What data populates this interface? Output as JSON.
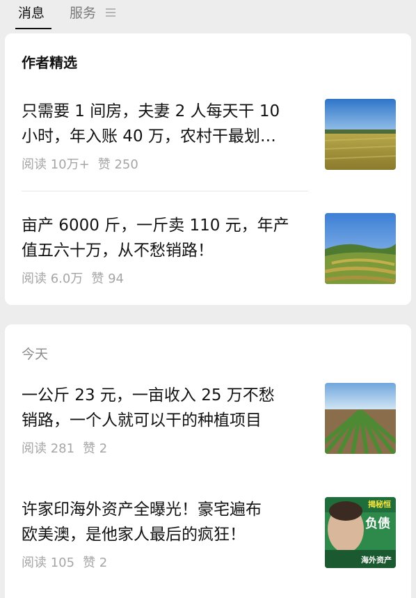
{
  "tabs": [
    {
      "label": "消息"
    },
    {
      "label": "服务"
    }
  ],
  "featured": {
    "title": "作者精选",
    "articles": [
      {
        "title_lines": [
          "只需要 1 间房，夫妻 2 人每天干 10",
          "小时，年入账 40 万，农村干最划…"
        ],
        "reads": "阅读 10万+",
        "likes": "赞 250",
        "thumb": "rice-field-image"
      },
      {
        "title_lines": [
          "亩产 6000 斤，一斤卖 110 元，年产",
          "值五六十万，从不愁销路！"
        ],
        "reads": "阅读 6.0万",
        "likes": "赞 94",
        "thumb": "terraced-field-image"
      }
    ]
  },
  "today": {
    "label": "今天",
    "articles": [
      {
        "title_lines": [
          "一公斤 23 元，一亩收入 25 万不愁",
          "销路，一个人就可以干的种植项目"
        ],
        "reads": "阅读 281",
        "likes": "赞 2",
        "thumb": "crop-rows-image"
      },
      {
        "title_lines": [
          "许家印海外资产全曝光！豪宅遍布",
          "欧美澳，是他家人最后的疯狂！"
        ],
        "reads": "阅读 105",
        "likes": "赞 2",
        "thumb": "news-portrait-image",
        "thumb_texts": [
          "揭秘恒",
          "负债",
          "海外资产"
        ]
      }
    ]
  }
}
